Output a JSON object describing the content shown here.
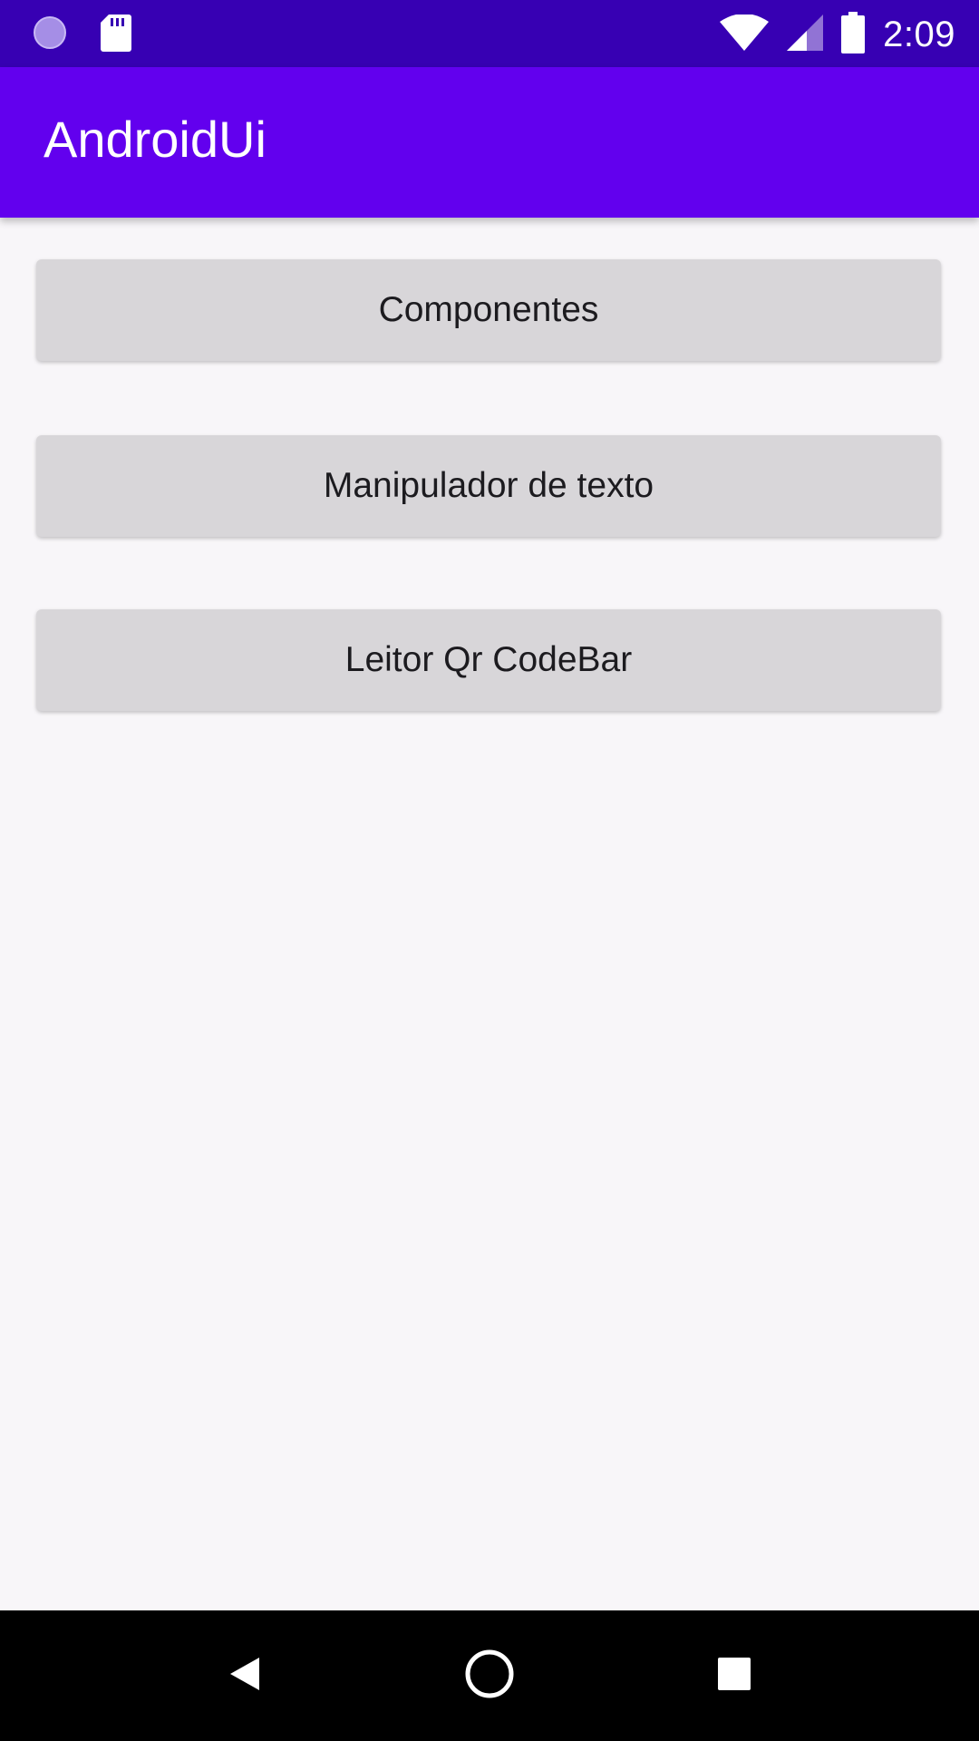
{
  "status_bar": {
    "time": "2:09",
    "icons": [
      "circle-notification-icon",
      "sd-card-icon",
      "wifi-icon",
      "cell-signal-icon",
      "battery-icon"
    ]
  },
  "app_bar": {
    "title": "AndroidUi"
  },
  "buttons": [
    {
      "label": "Componentes"
    },
    {
      "label": "Manipulador de texto"
    },
    {
      "label": "Leitor Qr CodeBar"
    }
  ],
  "nav_bar": {
    "icons": [
      "back-icon",
      "home-icon",
      "recents-icon"
    ]
  },
  "colors": {
    "status_bar": "#3700b3",
    "app_bar": "#6200ee",
    "button": "#d8d6d9",
    "background": "#f8f6f9",
    "nav_bar": "#000000"
  }
}
